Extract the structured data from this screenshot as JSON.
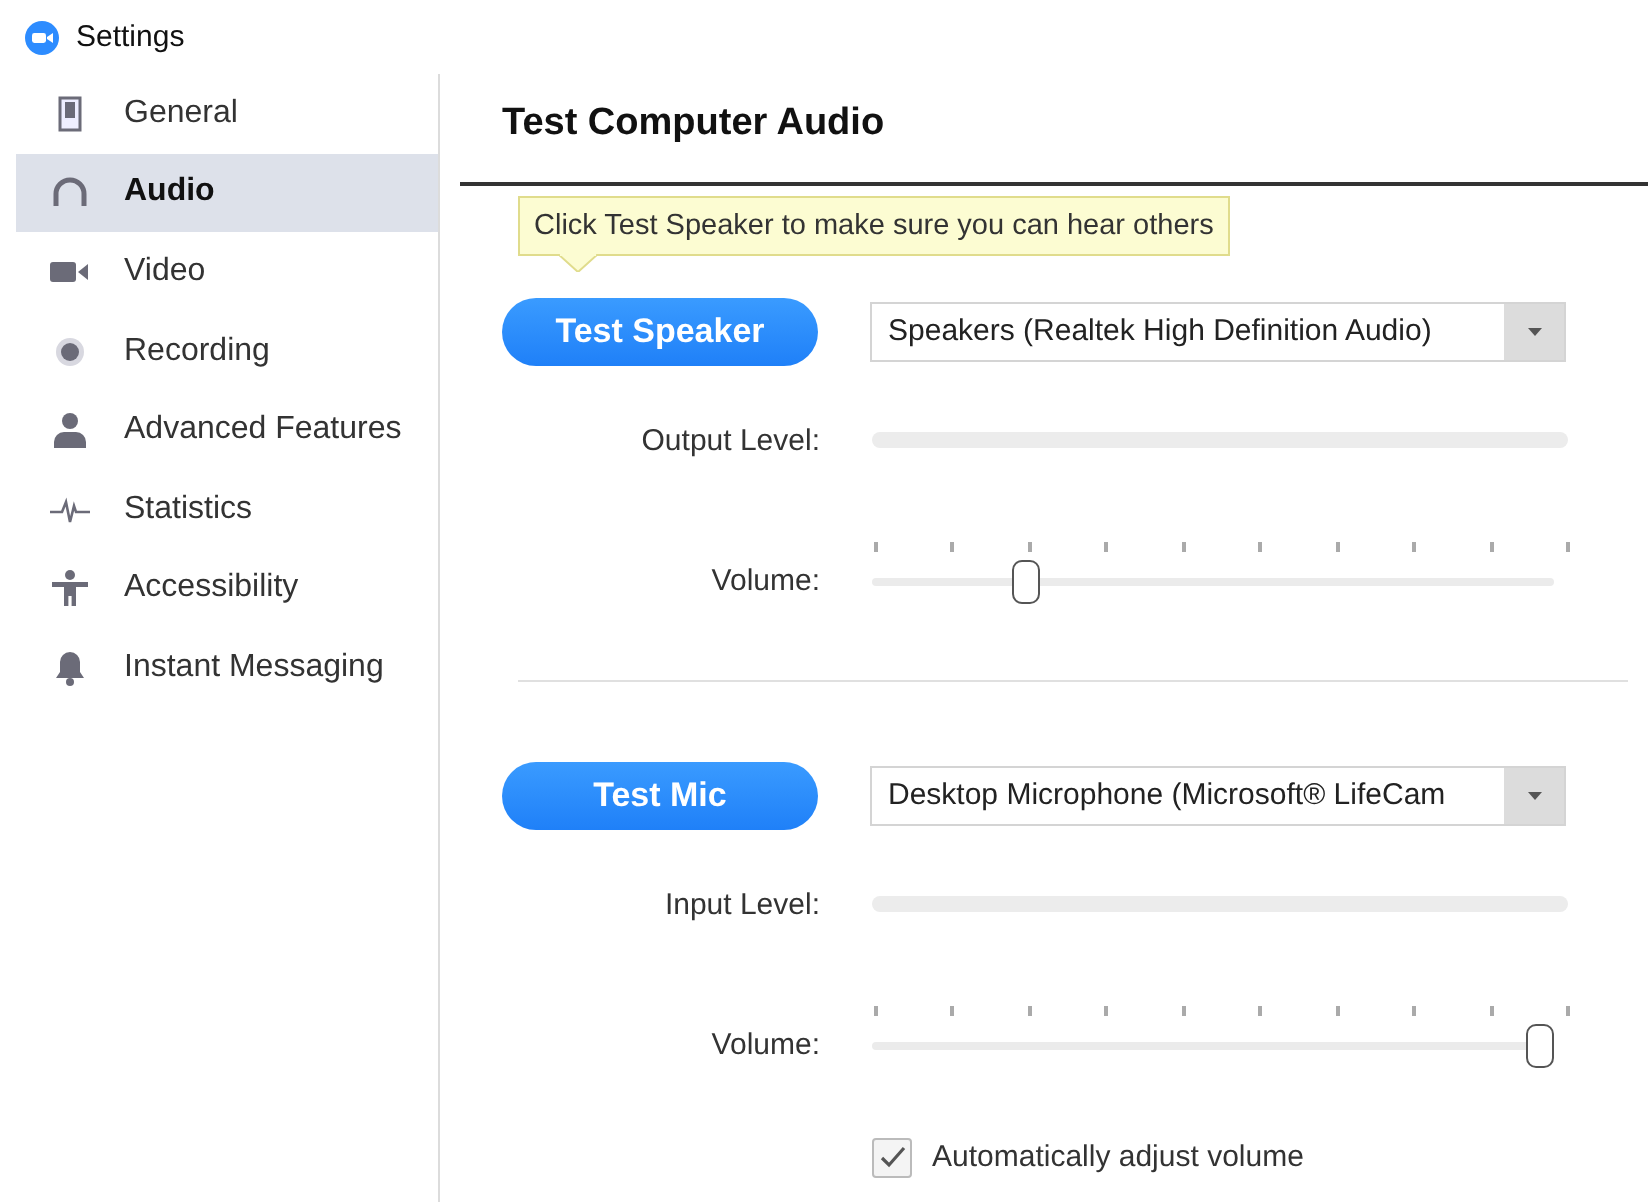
{
  "window": {
    "title": "Settings"
  },
  "sidebar": {
    "items": [
      {
        "label": "General",
        "selected": false
      },
      {
        "label": "Audio",
        "selected": true
      },
      {
        "label": "Video",
        "selected": false
      },
      {
        "label": "Recording",
        "selected": false
      },
      {
        "label": "Advanced Features",
        "selected": false
      },
      {
        "label": "Statistics",
        "selected": false
      },
      {
        "label": "Accessibility",
        "selected": false
      },
      {
        "label": "Instant Messaging",
        "selected": false
      }
    ]
  },
  "content": {
    "heading": "Test Computer Audio",
    "tooltip": "Click Test Speaker to make sure you can hear others",
    "sections": [
      {
        "button": "Test Speaker",
        "device": "Speakers (Realtek High Definition Audio)",
        "meter_label": "Output Level:",
        "meter": {
          "level": 0
        },
        "volume_label": "Volume:",
        "volume": {
          "level": 0.21
        }
      },
      {
        "button": "Test Mic",
        "device": "Desktop Microphone (Microsoft® LifeCam",
        "meter_label": "Input Level:",
        "meter": {
          "level": 0
        },
        "volume_label": "Volume:",
        "volume": {
          "level": 0.98
        },
        "auto_adjust": {
          "label": "Automatically adjust volume",
          "checked": true
        }
      }
    ]
  }
}
